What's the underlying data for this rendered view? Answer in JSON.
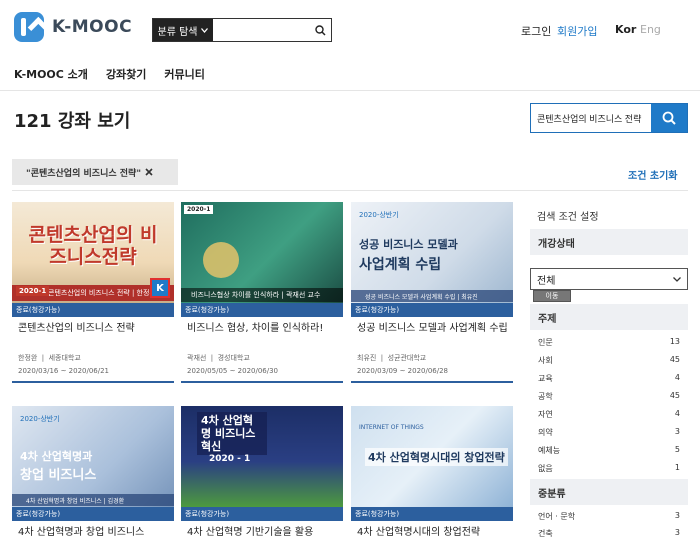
{
  "header": {
    "logo_text": "K-MOOC",
    "search_category": "분류 탐색",
    "search_placeholder": "",
    "login": "로그인",
    "signup": "회원가입",
    "lang_kor": "Kor",
    "lang_eng": "Eng"
  },
  "nav": {
    "items": [
      "K-MOOC 소개",
      "강좌찾기",
      "커뮤니티"
    ]
  },
  "page": {
    "title": "121 강좌 보기",
    "search_value": "콘텐츠산업의 비즈니스 전략",
    "filter_chip": "\"콘텐츠산업의 비즈니스 전략\"",
    "reset": "조건 초기화"
  },
  "cards": [
    {
      "thumb_big": "콘텐츠산업의 비즈니스전략",
      "thumb_tag": "2020-1",
      "thumb_sub": "콘텐츠산업의 비즈니스 전략 | 한정완",
      "badge": "K",
      "status": "종료(청강가능)",
      "title": "콘텐츠산업의 비즈니스 전략",
      "instructor": "한정완",
      "school": "세종대학교",
      "dates": "2020/03/16 ~ 2020/06/21"
    },
    {
      "thumb_yr": "2020-1",
      "thumb_sub": "비즈니스협상 차이를 인식하라 | 곽재선 교수",
      "status": "종료(청강가능)",
      "title": "비즈니스 협상, 차이를 인식하라!",
      "instructor": "곽재선",
      "school": "경성대학교",
      "dates": "2020/05/05 ~ 2020/06/30"
    },
    {
      "thumb_sm": "2020-상반기",
      "thumb_mid": "성공 비즈니스 모델과",
      "thumb_big": "사업계획 수립",
      "thumb_sub": "성공 비즈니스 모델과 사업계획 수립 | 최유진",
      "status": "종료(청강가능)",
      "title": "성공 비즈니스 모델과 사업계획 수립",
      "instructor": "최유진",
      "school": "성균관대학교",
      "dates": "2020/03/09 ~ 2020/06/28"
    },
    {
      "thumb_sm": "2020-상반기",
      "thumb_mid": "4차 산업혁명과",
      "thumb_big": "창업 비즈니스",
      "thumb_sub": "4차 산업혁명과 창업 비즈니스 | 김경환",
      "status": "종료(청강가능)",
      "title": "4차 산업혁명과 창업 비즈니스"
    },
    {
      "thumb_big": "4차 산업혁명 비즈니스 혁신",
      "thumb_yr": "2020 - 1",
      "status": "종료(청강가능)",
      "title": "4차 산업혁명 기반기술을 활용"
    },
    {
      "thumb_top": "INTERNET OF THINGS",
      "thumb_big": "4차 산업혁명시대의 창업전략",
      "status": "종료(청강가능)",
      "title": "4차 산업혁명시대의 창업전략"
    }
  ],
  "sidebar": {
    "head": "검색 조건 설정",
    "status_section": "개강상태",
    "status_select": "전체",
    "tooltip": "이동",
    "subject_section": "주제",
    "subjects": [
      {
        "name": "인문",
        "count": "13"
      },
      {
        "name": "사회",
        "count": "45"
      },
      {
        "name": "교육",
        "count": "4"
      },
      {
        "name": "공학",
        "count": "45"
      },
      {
        "name": "자연",
        "count": "4"
      },
      {
        "name": "의약",
        "count": "3"
      },
      {
        "name": "예체능",
        "count": "5"
      },
      {
        "name": "없음",
        "count": "1"
      }
    ],
    "mid_section": "중분류",
    "mids": [
      {
        "name": "언어 · 문학",
        "count": "3"
      },
      {
        "name": "건축",
        "count": "3"
      }
    ]
  }
}
